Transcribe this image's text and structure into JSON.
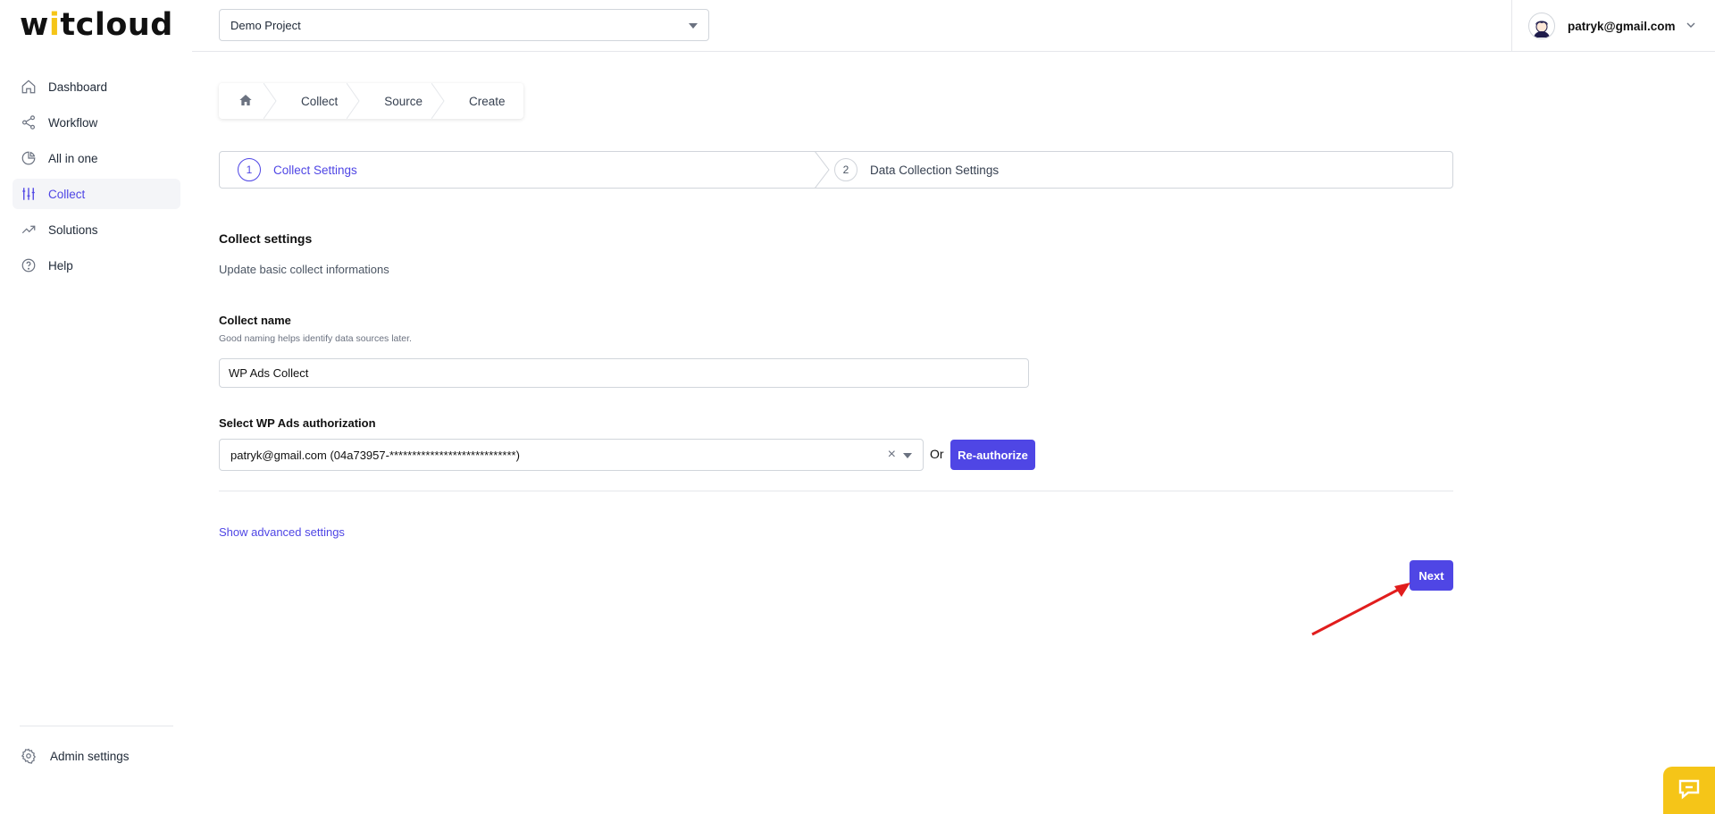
{
  "app": {
    "logo_prefix": "w",
    "logo_it": "i",
    "logo_rest": "tcloud"
  },
  "sidebar": {
    "items": [
      {
        "label": "Dashboard",
        "icon": "home-icon"
      },
      {
        "label": "Workflow",
        "icon": "share-icon"
      },
      {
        "label": "All in one",
        "icon": "pie-chart-icon"
      },
      {
        "label": "Collect",
        "icon": "sliders-icon",
        "active": true
      },
      {
        "label": "Solutions",
        "icon": "trending-up-icon"
      },
      {
        "label": "Help",
        "icon": "help-circle-icon"
      }
    ],
    "admin_label": "Admin settings"
  },
  "header": {
    "project": "Demo Project",
    "user_email": "patryk@gmail.com"
  },
  "breadcrumb": {
    "items": [
      "Collect",
      "Source",
      "Create"
    ]
  },
  "stepper": {
    "steps": [
      {
        "number": "1",
        "label": "Collect Settings",
        "active": true
      },
      {
        "number": "2",
        "label": "Data Collection Settings",
        "active": false
      }
    ]
  },
  "form": {
    "section_title": "Collect settings",
    "section_subtitle": "Update basic collect informations",
    "name_label": "Collect name",
    "name_help": "Good naming helps identify data sources later.",
    "name_value": "WP Ads Collect",
    "auth_label": "Select WP Ads authorization",
    "auth_value": "patryk@gmail.com (04a73957-****************************)",
    "or_text": "Or",
    "reauthorize_label": "Re-authorize",
    "advanced_link": "Show advanced settings",
    "next_label": "Next"
  },
  "colors": {
    "accent": "#4f46e5",
    "brand_yellow": "#f5c518",
    "annotation": "#e11d1d"
  }
}
